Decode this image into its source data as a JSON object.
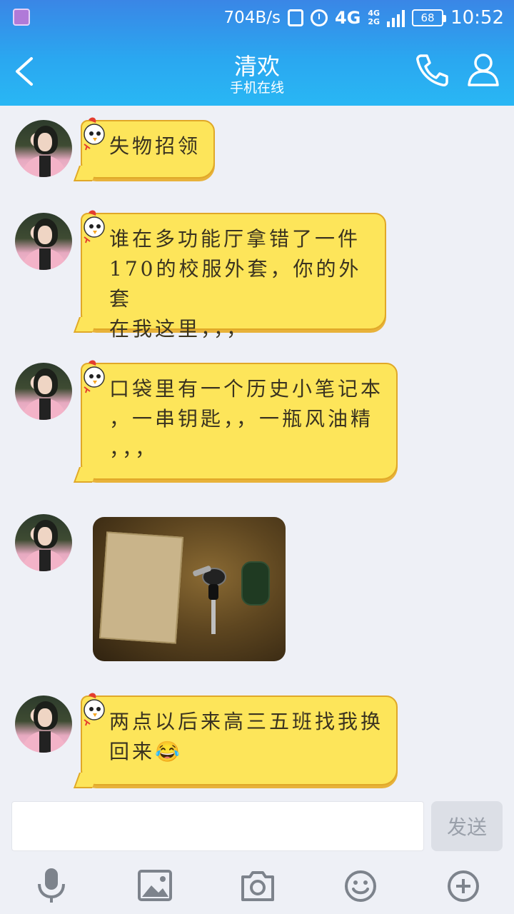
{
  "status_bar": {
    "net_speed": "704B/s",
    "network_4g": "4G",
    "sig_top": "4G",
    "sig_bottom": "2G",
    "battery": "68",
    "time": "10:52"
  },
  "header": {
    "title": "清欢",
    "subtitle": "手机在线",
    "icons": [
      "back-arrow-icon",
      "phone-icon",
      "profile-icon"
    ]
  },
  "messages": [
    {
      "type": "text",
      "text": "失物招领"
    },
    {
      "type": "text",
      "lines": [
        "谁在多功能厅拿错了一件",
        "170的校服外套，你的外套",
        "在我这里，，，"
      ]
    },
    {
      "type": "text",
      "lines": [
        "口袋里有一个历史小笔记本",
        "，一串钥匙，，一瓶风油精",
        "，，，"
      ]
    },
    {
      "type": "image",
      "description_icon": "photo-thumbnail"
    },
    {
      "type": "text",
      "lines": [
        "两点以后来高三五班找我换",
        "回来😂"
      ]
    }
  ],
  "composer": {
    "input_value": "",
    "send_label": "发送"
  },
  "toolbar": {
    "icons": [
      "microphone-icon",
      "image-icon",
      "camera-icon",
      "emoji-icon",
      "plus-icon"
    ]
  },
  "colors": {
    "header_top": "#3a86e6",
    "header_bottom": "#29b7f4",
    "bubble_fill": "#fde55a",
    "bubble_border": "#e0a828",
    "background": "#eef0f6"
  }
}
